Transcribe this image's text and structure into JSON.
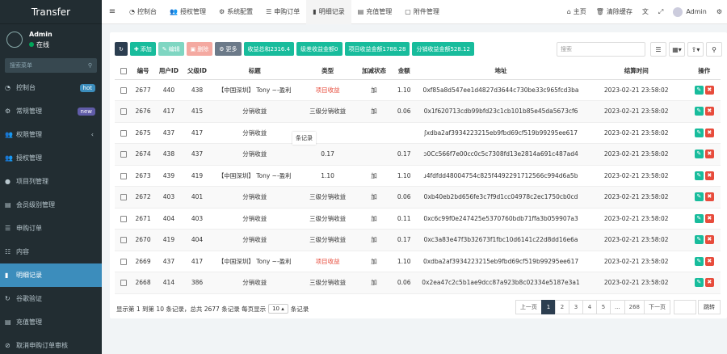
{
  "app": {
    "title": "Transfer"
  },
  "user": {
    "name": "Admin",
    "status": "在线"
  },
  "sidebar": {
    "search_placeholder": "搜索菜单",
    "items": [
      {
        "label": "控制台",
        "icon": "dashboard-icon",
        "badge": "hot"
      },
      {
        "label": "常规管理",
        "icon": "cogs-icon",
        "badge": "new"
      },
      {
        "label": "权限管理",
        "icon": "group-icon",
        "chevron": "‹"
      },
      {
        "label": "授权管理",
        "icon": "users-icon"
      },
      {
        "label": "项目列管理",
        "icon": "circle-icon"
      },
      {
        "label": "会员级别管理",
        "icon": "calendar-icon"
      },
      {
        "label": "申购订单",
        "icon": "list-icon"
      },
      {
        "label": "内容",
        "icon": "list-alt-icon"
      },
      {
        "label": "明细记录",
        "icon": "book-icon",
        "active": true
      },
      {
        "label": "谷歌验证",
        "icon": "refresh-icon"
      },
      {
        "label": "充值管理",
        "icon": "calendar-icon"
      },
      {
        "label": "取消申购订单审核",
        "icon": "ban-icon"
      }
    ]
  },
  "topbar": {
    "tabs": [
      {
        "label": "控制台",
        "icon": "dashboard-icon"
      },
      {
        "label": "授权管理",
        "icon": "users-icon"
      },
      {
        "label": "系统配置",
        "icon": "cog-icon"
      },
      {
        "label": "申购订单",
        "icon": "list-icon"
      },
      {
        "label": "明细记录",
        "icon": "book-icon",
        "active": true
      },
      {
        "label": "充值管理",
        "icon": "calendar-icon"
      },
      {
        "label": "附件管理",
        "icon": "file-icon"
      }
    ],
    "home": "主页",
    "clear_cache": "清除缓存",
    "admin": "Admin"
  },
  "toolbar": {
    "add": "添加",
    "edit": "编辑",
    "delete": "删除",
    "more": "更多",
    "stat1": "收益总和2316.4",
    "stat2": "级差收益金额0",
    "stat3": "项目收益金额1788.28",
    "stat4": "分销收益金额528.12",
    "search_placeholder": "搜索"
  },
  "table": {
    "headers": [
      "编号",
      "用户ID",
      "父级ID",
      "标题",
      "类型",
      "加减状态",
      "金额",
      "地址",
      "结算时间",
      "操作"
    ],
    "rows": [
      {
        "id": "2677",
        "uid": "440",
        "pid": "438",
        "title": "【中国深圳】 Tony ~-盈利",
        "type": "项目收益",
        "type_red": true,
        "sign": "加",
        "amount": "1.10",
        "addr": "0xf85a8d547ee1d4827d3644c730be33c965fcd3ba",
        "time": "2023-02-21 23:58:02"
      },
      {
        "id": "2676",
        "uid": "417",
        "pid": "415",
        "title": "分销收益",
        "type": "三级分销收益",
        "sign": "加",
        "amount": "0.06",
        "addr": "0x1f620713cdb99bfd23c1cb101b85e45da5673cf6",
        "time": "2023-02-21 23:58:02"
      },
      {
        "id": "2675",
        "uid": "437",
        "pid": "417",
        "title": "分销收益",
        "type": "",
        "sign": "",
        "amount": "",
        "addr": "ʃxdba2af3934223215eb9fbd69cf519b99295ee617",
        "time": "2023-02-21 23:58:02"
      },
      {
        "id": "2674",
        "uid": "438",
        "pid": "437",
        "title": "分销收益",
        "type": "0.17",
        "sign": "",
        "amount": "0.17",
        "addr": "ɔ0Cc566f7e00cc0c5c7308fd13e2814a691c487ad4",
        "time": "2023-02-21 23:58:02"
      },
      {
        "id": "2673",
        "uid": "439",
        "pid": "419",
        "title": "【中国深圳】 Tony ~-盈利",
        "type": "1.10",
        "sign": "加",
        "amount": "1.10",
        "addr": "ɹ4fdfdd48004754c825f4492291712566c994d6a5b",
        "time": "2023-02-21 23:58:02"
      },
      {
        "id": "2672",
        "uid": "403",
        "pid": "401",
        "title": "分销收益",
        "type": "三级分销收益",
        "sign": "加",
        "amount": "0.06",
        "addr": "0xb40eb2bd656fe3c7f9d1cc04978c2ec1750cb0cd",
        "time": "2023-02-21 23:58:02"
      },
      {
        "id": "2671",
        "uid": "404",
        "pid": "403",
        "title": "分销收益",
        "type": "三级分销收益",
        "sign": "加",
        "amount": "0.11",
        "addr": "0xc6c99f0e247425e5370760bdb71ffa3b059907a3",
        "time": "2023-02-21 23:58:02"
      },
      {
        "id": "2670",
        "uid": "419",
        "pid": "404",
        "title": "分销收益",
        "type": "三级分销收益",
        "sign": "加",
        "amount": "0.17",
        "addr": "0xc3a83e47f3b32673f1fbc10d6141c22d8dd16e6a",
        "time": "2023-02-21 23:58:02"
      },
      {
        "id": "2669",
        "uid": "437",
        "pid": "417",
        "title": "【中国深圳】 Tony ~-盈利",
        "type": "项目收益",
        "type_red": true,
        "sign": "加",
        "amount": "1.10",
        "addr": "0xdba2af3934223215eb9fbd69cf519b99295ee617",
        "time": "2023-02-21 23:58:02"
      },
      {
        "id": "2668",
        "uid": "414",
        "pid": "386",
        "title": "分销收益",
        "type": "三级分销收益",
        "sign": "加",
        "amount": "0.06",
        "addr": "0x2ea47c2c5b1ae9dcc87a923b8c02334e5187e3a1",
        "time": "2023-02-21 23:58:02"
      }
    ]
  },
  "tooltip": {
    "text": "条记录"
  },
  "pagination": {
    "info_pre": "显示第 1 到第 10 条记录，总共 2677 条记录 每页显示",
    "page_size": "10",
    "info_post": "条记录",
    "prev": "上一页",
    "pages": [
      "1",
      "2",
      "3",
      "4",
      "5",
      "...",
      "268"
    ],
    "next": "下一页",
    "jump": "跳转"
  }
}
